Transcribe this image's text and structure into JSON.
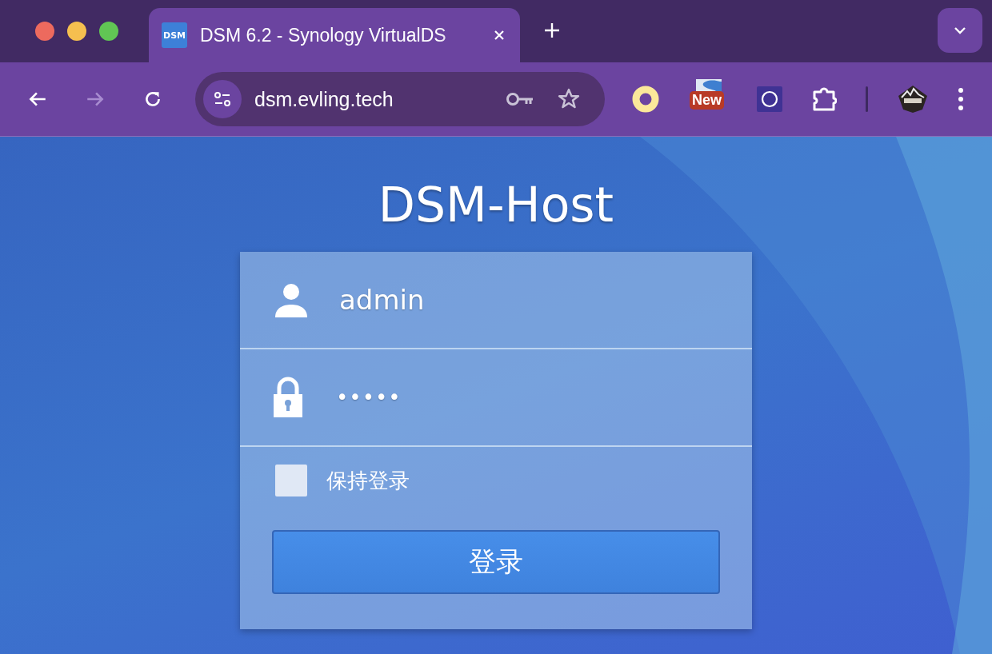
{
  "browser": {
    "tabs": [
      {
        "favicon_text": "DSM",
        "title": "DSM 6.2 - Synology VirtualDS",
        "selected": true
      }
    ],
    "nav": [
      {
        "kind": "back",
        "disabled": false
      },
      {
        "kind": "forward",
        "disabled": true
      },
      {
        "kind": "reload",
        "disabled": false
      }
    ],
    "address": {
      "url": "dsm.evling.tech"
    },
    "extensions": [
      {
        "kind": "ring"
      },
      {
        "kind": "badge",
        "badge": "New"
      },
      {
        "kind": "circle-square"
      },
      {
        "kind": "puzzle"
      },
      {
        "kind": "divider"
      },
      {
        "kind": "profile"
      },
      {
        "kind": "menu"
      }
    ]
  },
  "login": {
    "heading": "DSM-Host",
    "username": {
      "value": "admin"
    },
    "password": {
      "value": "•••••"
    },
    "remember": {
      "label": "保持登录",
      "checked": false
    },
    "submit": "登录"
  }
}
